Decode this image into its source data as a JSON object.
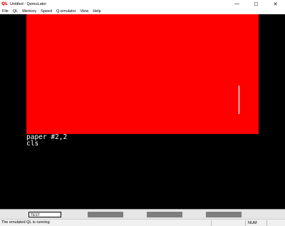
{
  "window": {
    "app_icon_text": "QL",
    "title": "Untitled - QemuLator",
    "minimize_glyph": "—",
    "maximize_glyph": "☐",
    "close_glyph": "✕"
  },
  "menu": [
    "File",
    "QL",
    "Memory",
    "Speed",
    "Q-emulator",
    "View",
    "Help"
  ],
  "screen": {
    "paper_color": "#ff0000",
    "console_lines": [
      "paper #2,2",
      "cls"
    ]
  },
  "drives": {
    "slot1_value": "TEST"
  },
  "status": {
    "message": "The emulated QL is running",
    "indicator": "NUM"
  },
  "colors": {
    "screen_background": "#000000",
    "paper": "#ff0000",
    "ink": "#ffffff"
  }
}
